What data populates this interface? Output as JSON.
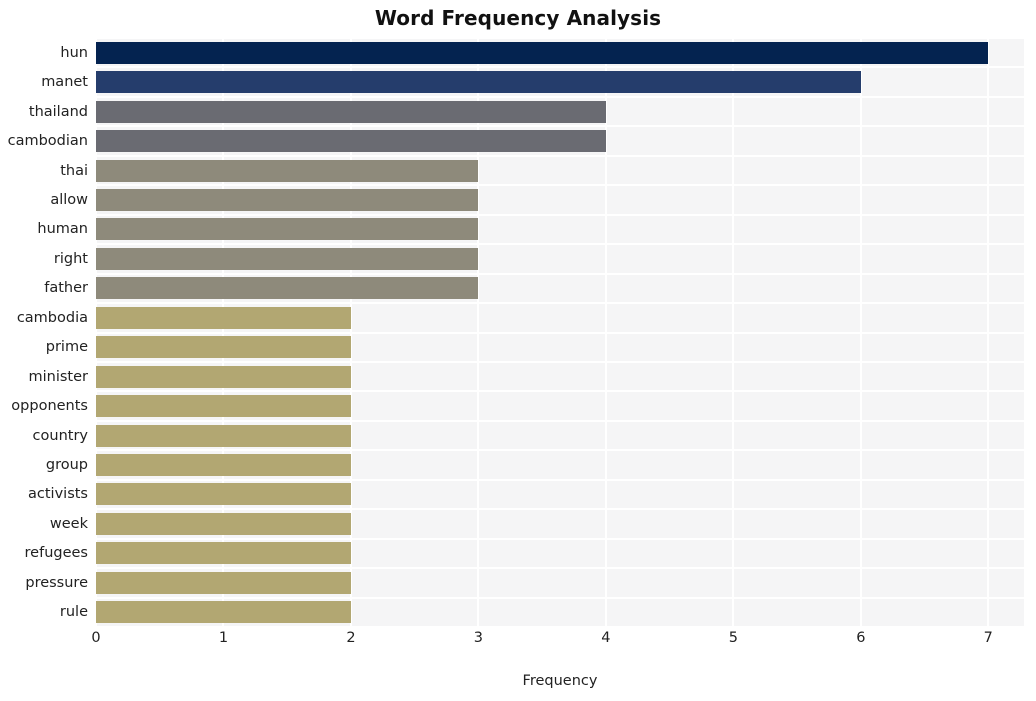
{
  "chart_data": {
    "type": "bar",
    "orientation": "horizontal",
    "title": "Word Frequency Analysis",
    "xlabel": "Frequency",
    "ylabel": "",
    "categories": [
      "hun",
      "manet",
      "thailand",
      "cambodian",
      "thai",
      "allow",
      "human",
      "right",
      "father",
      "cambodia",
      "prime",
      "minister",
      "opponents",
      "country",
      "group",
      "activists",
      "week",
      "refugees",
      "pressure",
      "rule"
    ],
    "values": [
      7,
      6,
      4,
      4,
      3,
      3,
      3,
      3,
      3,
      2,
      2,
      2,
      2,
      2,
      2,
      2,
      2,
      2,
      2,
      2
    ],
    "bar_colors": [
      "#042350",
      "#253d6c",
      "#6a6b72",
      "#6a6b72",
      "#8e8a7b",
      "#8e8a7b",
      "#8e8a7b",
      "#8e8a7b",
      "#8e8a7b",
      "#b2a772",
      "#b2a772",
      "#b2a772",
      "#b2a772",
      "#b2a772",
      "#b2a772",
      "#b2a772",
      "#b2a772",
      "#b2a772",
      "#b2a772",
      "#b2a772"
    ],
    "xlim": [
      0,
      7.28
    ],
    "xticks": [
      0,
      1,
      2,
      3,
      4,
      5,
      6,
      7
    ],
    "xtick_labels": [
      "0",
      "1",
      "2",
      "3",
      "4",
      "5",
      "6",
      "7"
    ],
    "grid": true,
    "grid_color": "#ffffff",
    "plot_background": "#f5f5f6",
    "figure_background": "#ffffff",
    "legend": null
  }
}
